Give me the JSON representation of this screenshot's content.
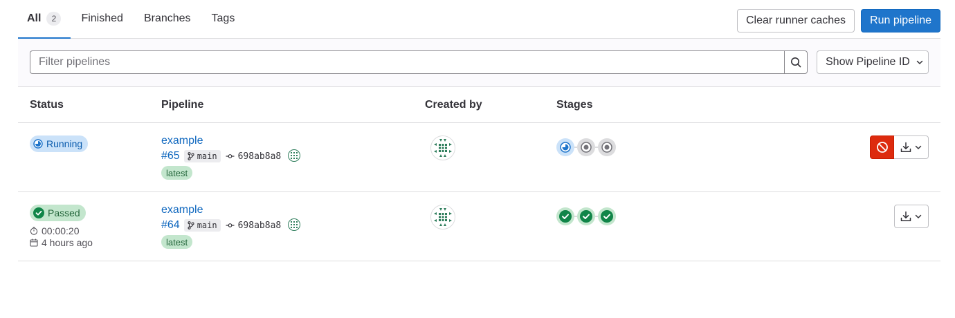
{
  "tabs": [
    {
      "label": "All",
      "count": "2",
      "active": true
    },
    {
      "label": "Finished"
    },
    {
      "label": "Branches"
    },
    {
      "label": "Tags"
    }
  ],
  "actions": {
    "clear_caches": "Clear runner caches",
    "run_pipeline": "Run pipeline"
  },
  "filter": {
    "placeholder": "Filter pipelines",
    "id_dropdown": "Show Pipeline ID"
  },
  "table": {
    "headers": {
      "status": "Status",
      "pipeline": "Pipeline",
      "created_by": "Created by",
      "stages": "Stages"
    },
    "rows": [
      {
        "status": "Running",
        "status_color": "#1f75cb",
        "name": "example",
        "id": "#65",
        "ref": "main",
        "commit": "698ab8a8",
        "tag": "latest",
        "stages": [
          "running",
          "created",
          "created"
        ]
      },
      {
        "status": "Passed",
        "status_color": "#108548",
        "duration": "00:00:20",
        "finished": "4 hours ago",
        "name": "example",
        "id": "#64",
        "ref": "main",
        "commit": "698ab8a8",
        "tag": "latest",
        "stages": [
          "success",
          "success",
          "success"
        ]
      }
    ]
  },
  "colors": {
    "accent": "#1f75cb",
    "danger": "#dd2b0e",
    "success": "#108548"
  }
}
